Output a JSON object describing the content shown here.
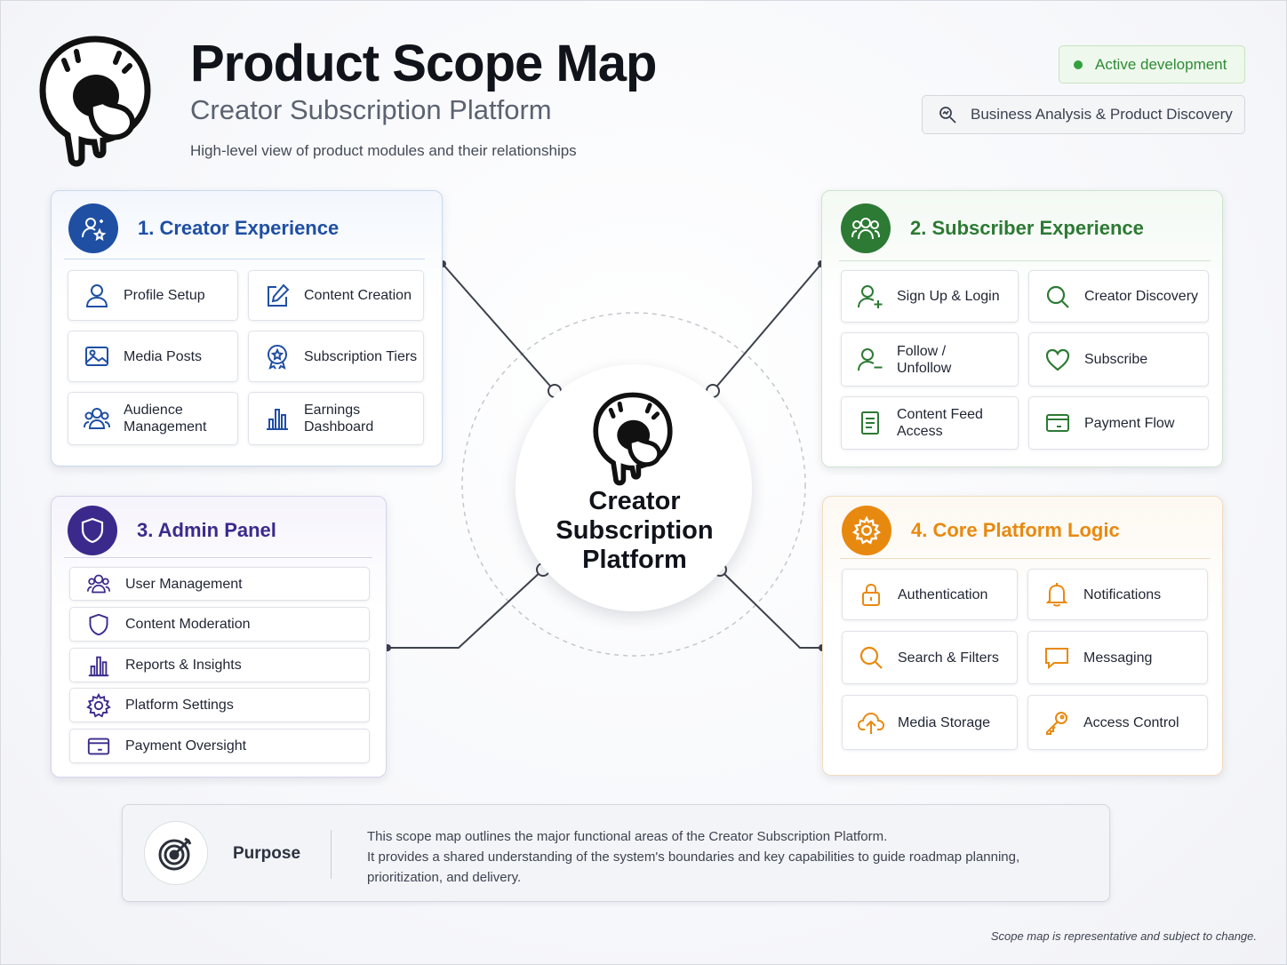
{
  "header": {
    "title": "Product Scope Map",
    "subtitle": "Creator Subscription Platform",
    "tagline": "High-level view of product modules and their relationships",
    "status_badge": "Active development",
    "category_badge": "Business Analysis & Product Discovery",
    "logo_icon": "dripping-donut-logo-icon"
  },
  "center": {
    "line1": "Creator",
    "line2": "Subscription",
    "line3": "Platform"
  },
  "modules": [
    {
      "title": "1. Creator Experience",
      "accent": "#1f4fa3",
      "icon": "user-star-icon",
      "items": [
        {
          "label": "Profile Setup",
          "icon": "user-icon"
        },
        {
          "label": "Content Creation",
          "icon": "edit-icon"
        },
        {
          "label": "Media Posts",
          "icon": "image-icon"
        },
        {
          "label": "Subscription Tiers",
          "icon": "badge-star-icon"
        },
        {
          "label": "Audience\nManagement",
          "icon": "users-icon"
        },
        {
          "label": "Earnings\nDashboard",
          "icon": "bar-chart-icon"
        }
      ]
    },
    {
      "title": "2. Subscriber Experience",
      "accent": "#2c7a34",
      "icon": "group-icon",
      "items": [
        {
          "label": "Sign Up & Login",
          "icon": "user-plus-icon"
        },
        {
          "label": "Creator Discovery",
          "icon": "search-icon"
        },
        {
          "label": "Follow /\nUnfollow",
          "icon": "user-minus-icon"
        },
        {
          "label": "Subscribe",
          "icon": "heart-icon"
        },
        {
          "label": "Content Feed\nAccess",
          "icon": "document-icon"
        },
        {
          "label": "Payment Flow",
          "icon": "card-icon"
        }
      ]
    },
    {
      "title": "3. Admin Panel",
      "accent": "#3b2a8c",
      "icon": "shield-icon",
      "items": [
        {
          "label": "User Management",
          "icon": "users-icon"
        },
        {
          "label": "Content Moderation",
          "icon": "shield-icon"
        },
        {
          "label": "Reports & Insights",
          "icon": "bar-chart-icon"
        },
        {
          "label": "Platform Settings",
          "icon": "gear-icon"
        },
        {
          "label": "Payment Oversight",
          "icon": "card-icon"
        }
      ]
    },
    {
      "title": "4. Core Platform Logic",
      "accent": "#e8890f",
      "icon": "gear-icon",
      "items": [
        {
          "label": "Authentication",
          "icon": "lock-icon"
        },
        {
          "label": "Notifications",
          "icon": "bell-icon"
        },
        {
          "label": "Search & Filters",
          "icon": "search-icon"
        },
        {
          "label": "Messaging",
          "icon": "chat-icon"
        },
        {
          "label": "Media Storage",
          "icon": "cloud-upload-icon"
        },
        {
          "label": "Access Control",
          "icon": "key-icon"
        }
      ]
    }
  ],
  "purpose": {
    "label": "Purpose",
    "line1": "This scope map outlines the major functional areas of the Creator Subscription Platform.",
    "line2": "It provides a shared understanding of the system's boundaries and key capabilities to guide roadmap planning,",
    "line3": "prioritization, and delivery.",
    "icon": "target-icon"
  },
  "footnote": "Scope map is representative and subject to change."
}
